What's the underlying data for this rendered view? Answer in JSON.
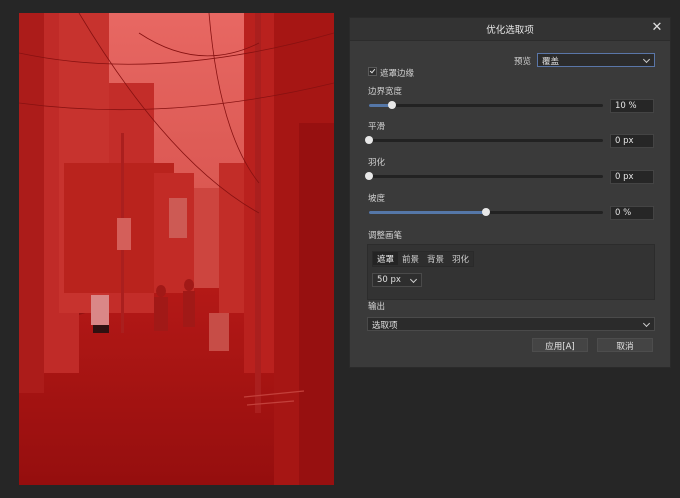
{
  "dialog": {
    "title": "优化选取项",
    "close_glyph": "✕",
    "preview_label": "预览",
    "preview_value": "覆盖",
    "mask_edge_label": "遮罩边缘",
    "mask_edge_checked": true,
    "sliders": [
      {
        "label": "边界宽度",
        "value": "10 %",
        "fraction": 0.1
      },
      {
        "label": "平滑",
        "value": "0 px",
        "fraction": 0.0
      },
      {
        "label": "羽化",
        "value": "0 px",
        "fraction": 0.0
      },
      {
        "label": "坡度",
        "value": "0 %",
        "fraction": 0.5
      }
    ],
    "brush_section_label": "调整画笔",
    "brush_modes": [
      "遮罩",
      "前景",
      "背景",
      "羽化"
    ],
    "brush_mode_selected": "遮罩",
    "brush_size": "50 px",
    "output_label": "输出",
    "output_value": "选取项",
    "apply_button": "应用[A]",
    "cancel_button": "取消"
  },
  "colors": {
    "overlay_red": "#c01414",
    "accent_blue": "#5577a8"
  },
  "icons": [
    "close-icon",
    "checkmark-icon",
    "chevron-down-icon"
  ]
}
